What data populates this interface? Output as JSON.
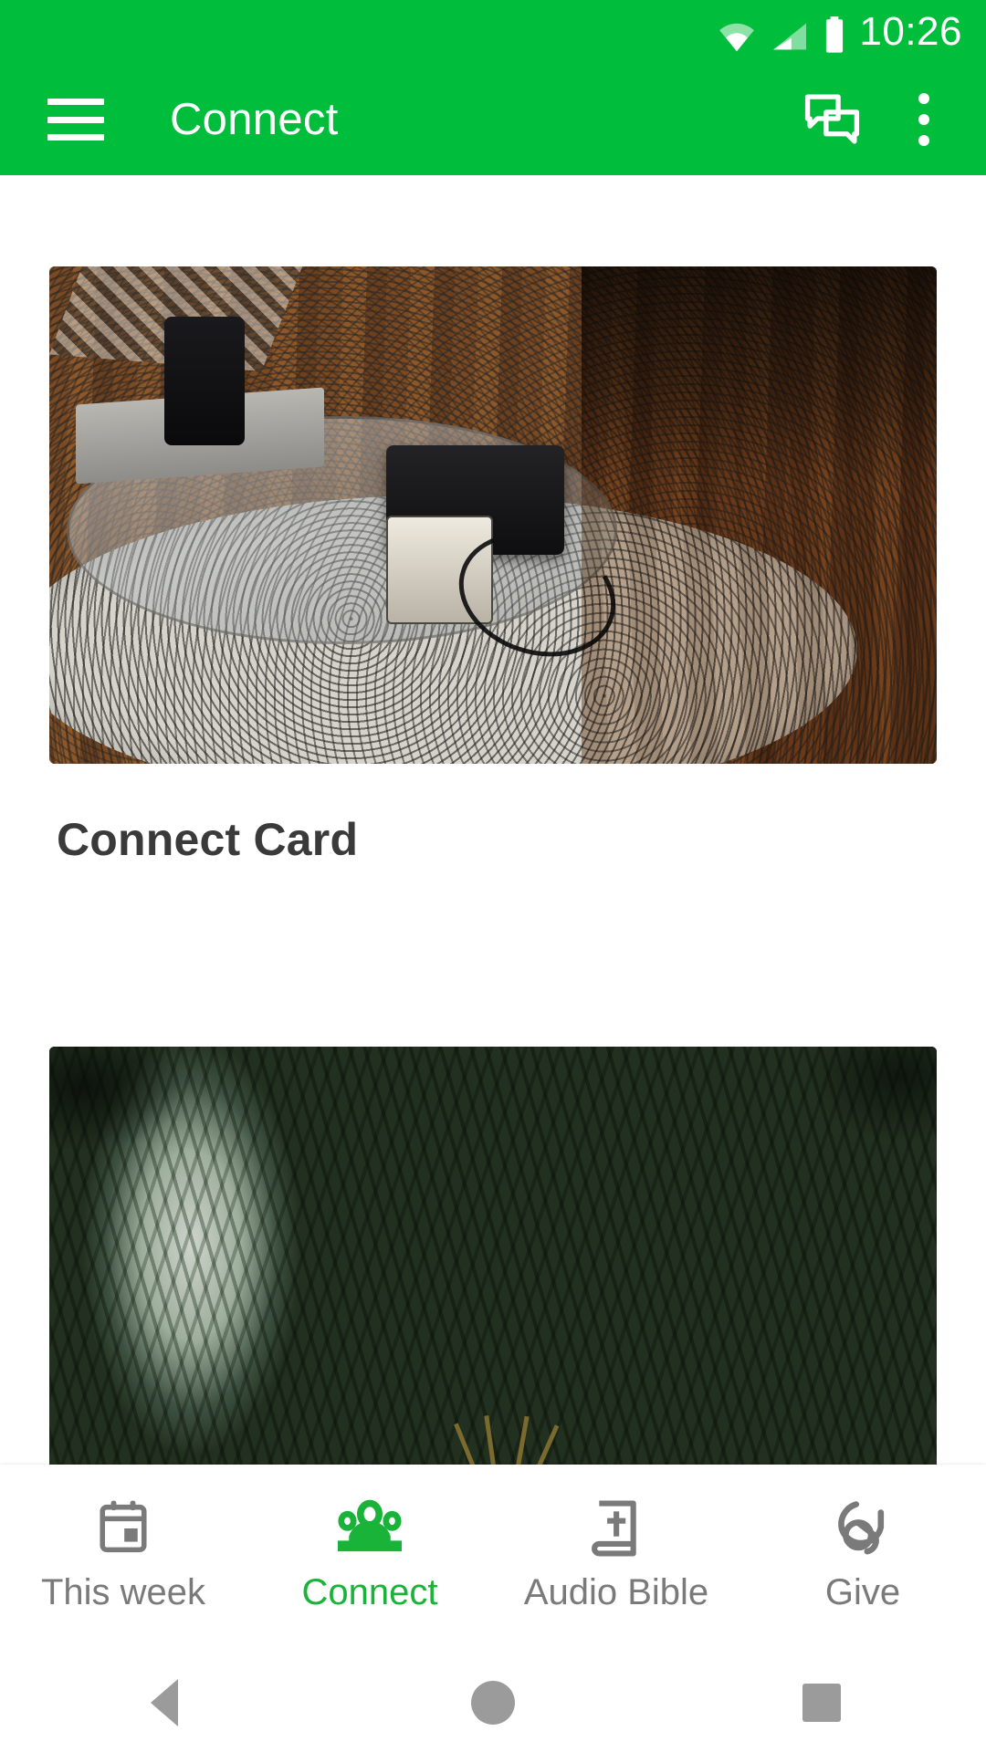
{
  "status_bar": {
    "time": "10:26",
    "icons": [
      "wifi-icon",
      "cellular-signal-icon",
      "battery-icon"
    ]
  },
  "app_bar": {
    "title": "Connect",
    "menu_icon": "hamburger-menu-icon",
    "chat_icon": "chat-bubbles-icon",
    "overflow_icon": "more-vertical-icon",
    "background_color": "#00BE3C",
    "text_color": "#FFFFFF"
  },
  "content": {
    "cards": [
      {
        "title": "Connect Card",
        "image_alt": "camera on glass coffee table in living room"
      },
      {
        "title": "",
        "image_alt": "close-up of silver and green variegated leaves"
      }
    ]
  },
  "bottom_nav": {
    "active_color": "#1AB33A",
    "inactive_color": "#7A7A7A",
    "items": [
      {
        "label": "This week",
        "icon": "calendar-icon",
        "active": false
      },
      {
        "label": "Connect",
        "icon": "people-group-icon",
        "active": true
      },
      {
        "label": "Audio Bible",
        "icon": "bible-book-icon",
        "active": false
      },
      {
        "label": "Give",
        "icon": "hand-coin-icon",
        "active": false
      }
    ]
  },
  "system_nav": {
    "back": "back-triangle-icon",
    "home": "home-circle-icon",
    "recents": "recents-square-icon"
  }
}
